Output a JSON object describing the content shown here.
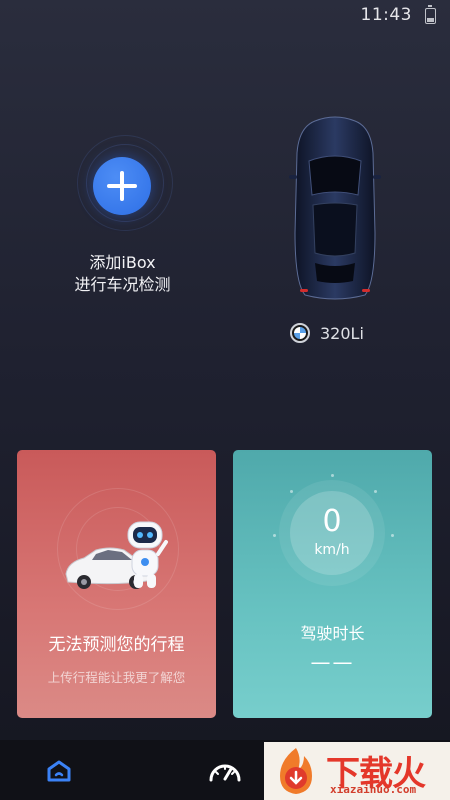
{
  "status_bar": {
    "time": "11:43"
  },
  "add_ibox": {
    "line1": "添加iBox",
    "line2": "进行车况检测"
  },
  "car": {
    "model": "320Li"
  },
  "trip_card": {
    "title": "无法预测您的行程",
    "subtitle": "上传行程能让我更了解您"
  },
  "drive_card": {
    "speed_value": "0",
    "speed_unit": "km/h",
    "title": "驾驶时长",
    "duration": "——"
  },
  "bottom_nav": {
    "items": [
      {
        "icon": "home-icon"
      },
      {
        "icon": "speedometer-icon"
      }
    ]
  },
  "watermark": {
    "text": "下载火",
    "url": "xiazaihuo.com"
  },
  "colors": {
    "accent": "#2e6fe6",
    "trip_card": "#d16866",
    "drive_card": "#5fb9b8",
    "nav_bg": "#101117"
  }
}
